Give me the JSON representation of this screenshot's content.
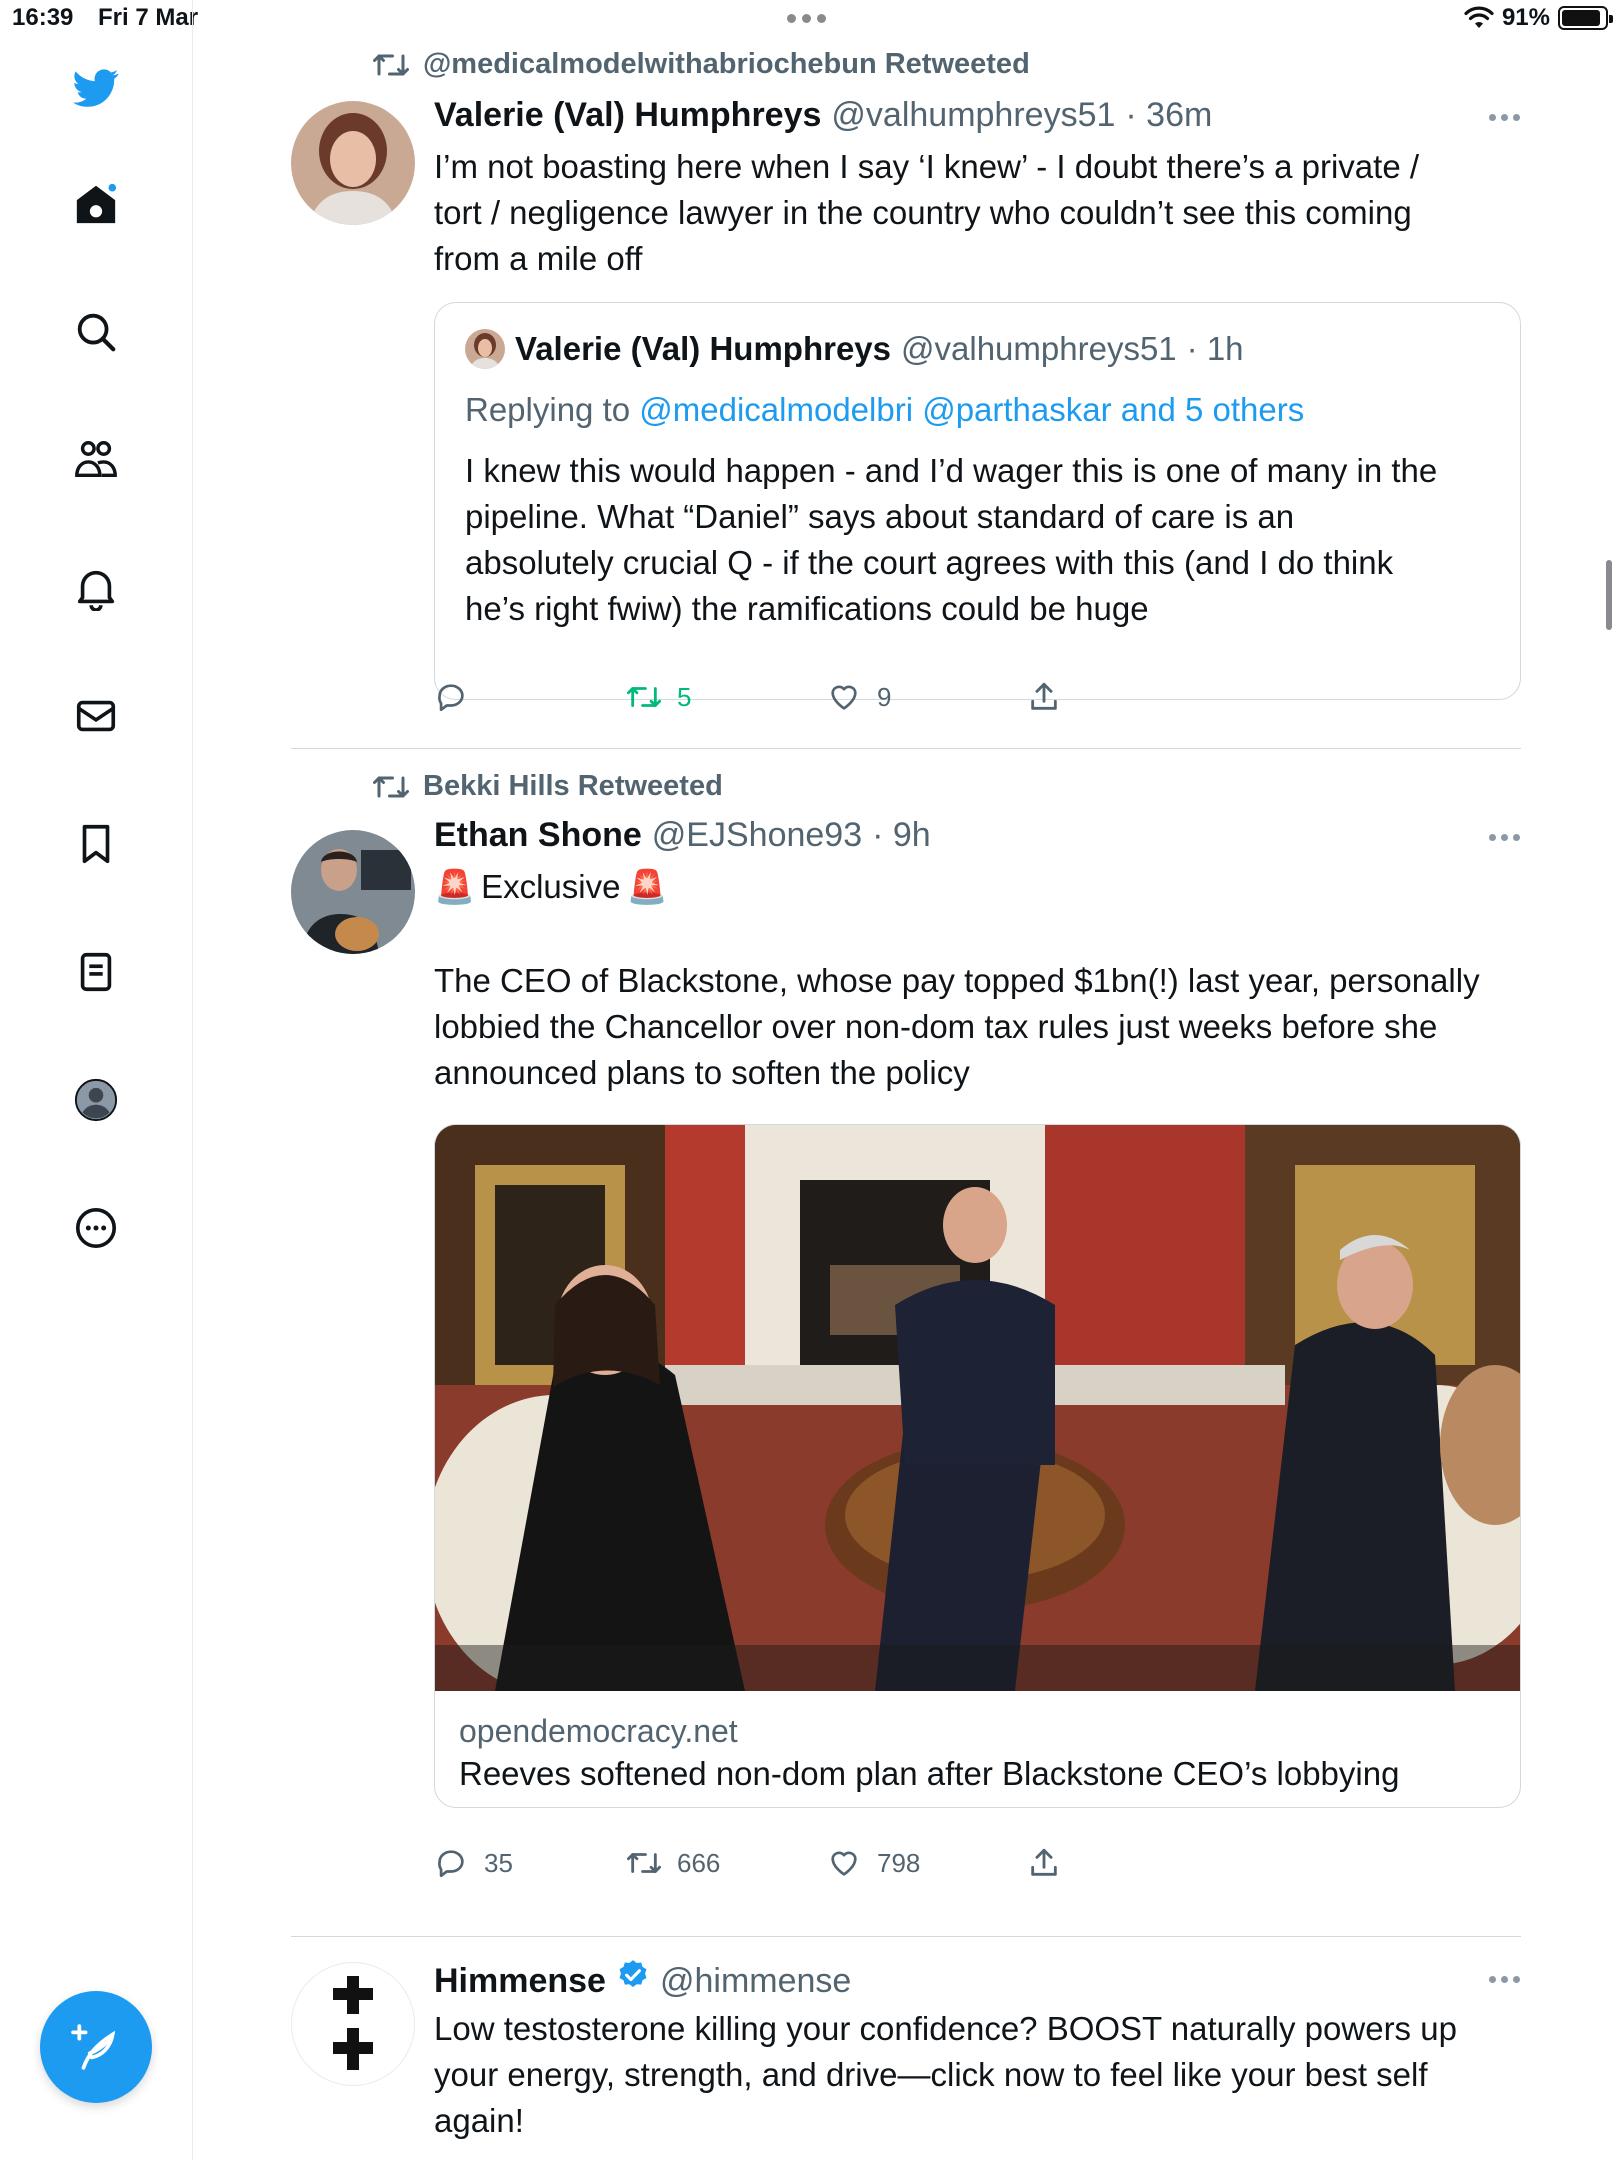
{
  "status_bar": {
    "time": "16:39",
    "date": "Fri 7 Mar",
    "battery": "91%",
    "battery_level": 0.91
  },
  "sidebar": {
    "items": [
      {
        "name": "twitter-logo",
        "icon": "bird"
      },
      {
        "name": "home",
        "icon": "home",
        "notification_dot": true
      },
      {
        "name": "explore",
        "icon": "search"
      },
      {
        "name": "communities",
        "icon": "people"
      },
      {
        "name": "notifications",
        "icon": "bell"
      },
      {
        "name": "messages",
        "icon": "envelope"
      },
      {
        "name": "bookmarks",
        "icon": "bookmark"
      },
      {
        "name": "lists",
        "icon": "list"
      },
      {
        "name": "profile",
        "icon": "avatar"
      },
      {
        "name": "more",
        "icon": "ellipsis-circle"
      }
    ],
    "compose_icon": "feather-plus"
  },
  "feed": {
    "tweets": [
      {
        "retweeted_by": "@medicalmodelwithabriochebun Retweeted",
        "name": "Valerie (Val) Humphreys",
        "handle": "@valhumphreys51",
        "time": "· 36m",
        "text": "I’m not boasting here when I say ‘I knew’ - I doubt there’s a private /\ntort / negligence lawyer in the country who couldn’t see this coming\nfrom a mile off",
        "quote": {
          "name": "Valerie (Val) Humphreys",
          "handle": "@valhumphreys51",
          "time": "· 1h",
          "replying_prefix": "Replying to ",
          "replying_to": "@medicalmodelbri @parthaskar and 5 others",
          "text": "I knew this would happen - and I’d wager this is one of many in the\npipeline. What “Daniel” says about standard of care is an\nabsolutely crucial Q - if the court agrees with this (and I do think\nhe’s right fwiw) the ramifications could be huge"
        },
        "replies": "",
        "retweets": "5",
        "likes": "9"
      },
      {
        "retweeted_by": "Bekki Hills Retweeted",
        "name": "Ethan Shone",
        "handle": "@EJShone93",
        "time": "· 9h",
        "headline": "Exclusive",
        "text": "The CEO of Blackstone, whose pay topped $1bn(!) last year, personally\nlobbied the Chancellor over non-dom tax rules just weeks before she\nannounced plans to soften the policy",
        "card": {
          "domain": "opendemocracy.net",
          "title": "Reeves softened non-dom plan after Blackstone CEO’s lobbying"
        },
        "replies": "35",
        "retweets": "666",
        "likes": "798"
      },
      {
        "name": "Himmense",
        "handle": "@himmense",
        "verified": true,
        "text": "Low testosterone killing your confidence? BOOST naturally powers up\nyour energy, strength, and drive—click now to feel like your best self\nagain!"
      }
    ]
  },
  "colors": {
    "accent": "#1d9bf0",
    "retweet_active": "#00ba7c",
    "muted": "#536471",
    "border": "#cfd9de"
  }
}
